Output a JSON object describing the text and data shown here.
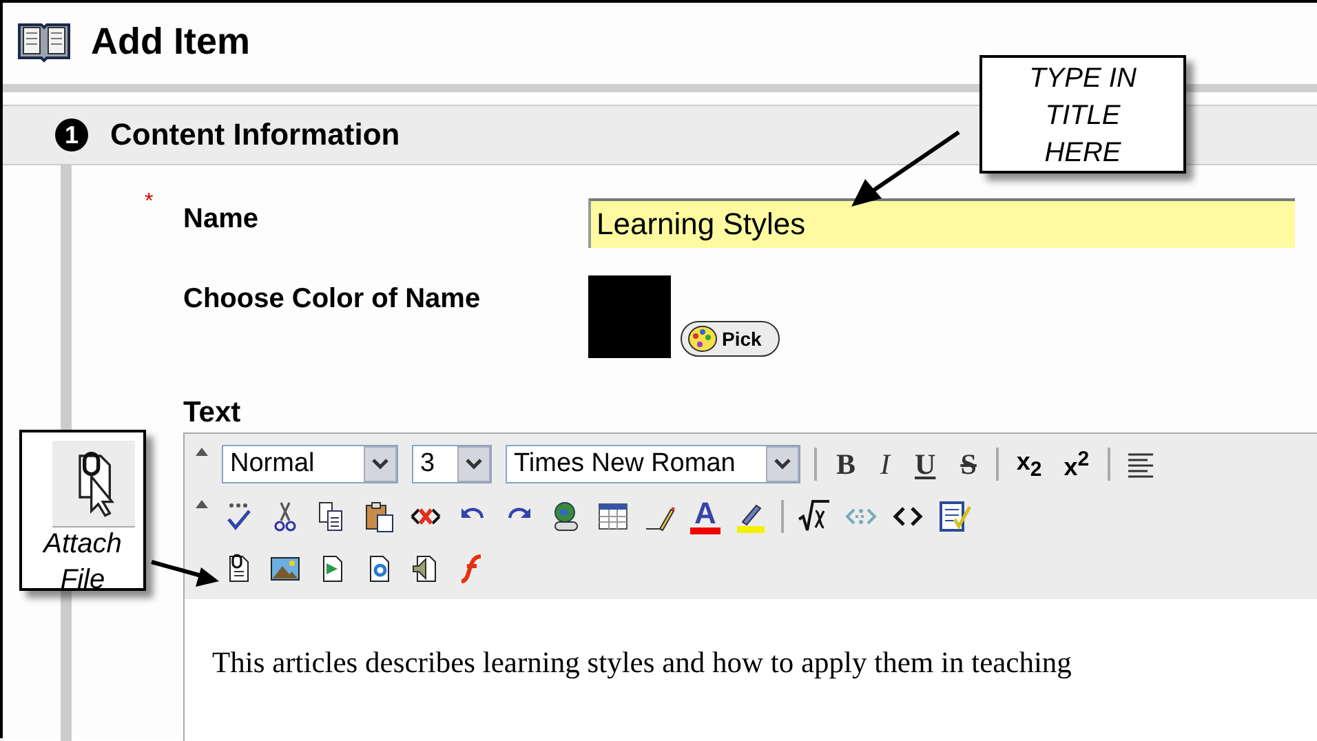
{
  "page": {
    "title": "Add Item"
  },
  "section": {
    "number": "1",
    "title": "Content Information"
  },
  "name_field": {
    "required_mark": "*",
    "label": "Name",
    "value": "Learning Styles"
  },
  "color_field": {
    "label": "Choose Color of Name",
    "color": "#000000",
    "button": "Pick"
  },
  "editor": {
    "label": "Text",
    "selects": [
      {
        "value": "Normal"
      },
      {
        "value": "3"
      },
      {
        "value": "Times New Roman"
      }
    ],
    "format_buttons": [
      {
        "kind": "bold",
        "label": "B"
      },
      {
        "kind": "italic",
        "label": "I"
      },
      {
        "kind": "underline",
        "label": "U"
      },
      {
        "kind": "strike",
        "label": "S"
      }
    ],
    "script_buttons": [
      {
        "label": "x$_{2}$"
      },
      {
        "label": "x$^{2}$"
      }
    ],
    "font_color_label": "A",
    "body": "This articles describes learning styles and how to apply them in teaching"
  },
  "callouts": [
    {
      "kind": "note",
      "text": "TYPE IN TITLE HERE"
    },
    {
      "kind": "button_zoom",
      "text": "Attach File"
    }
  ]
}
